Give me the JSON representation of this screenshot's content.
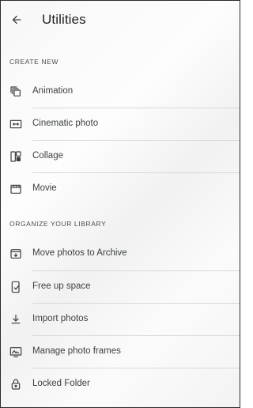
{
  "header": {
    "title": "Utilities",
    "back_icon": "arrow-back-icon"
  },
  "sections": {
    "create_new": {
      "title": "CREATE NEW",
      "items": [
        {
          "label": "Animation",
          "icon": "animation-icon"
        },
        {
          "label": "Cinematic photo",
          "icon": "cinematic-photo-icon"
        },
        {
          "label": "Collage",
          "icon": "collage-icon"
        },
        {
          "label": "Movie",
          "icon": "movie-icon"
        }
      ]
    },
    "organize": {
      "title": "ORGANIZE YOUR LIBRARY",
      "items": [
        {
          "label": "Move photos to Archive",
          "icon": "archive-icon"
        },
        {
          "label": "Free up space",
          "icon": "free-up-space-icon"
        },
        {
          "label": "Import photos",
          "icon": "download-icon"
        },
        {
          "label": "Manage photo frames",
          "icon": "photo-frame-icon"
        },
        {
          "label": "Locked Folder",
          "icon": "lock-icon"
        }
      ]
    }
  },
  "colors": {
    "text_primary": "#202124",
    "text_secondary": "#3c4043",
    "divider": "#d9d9d9"
  }
}
